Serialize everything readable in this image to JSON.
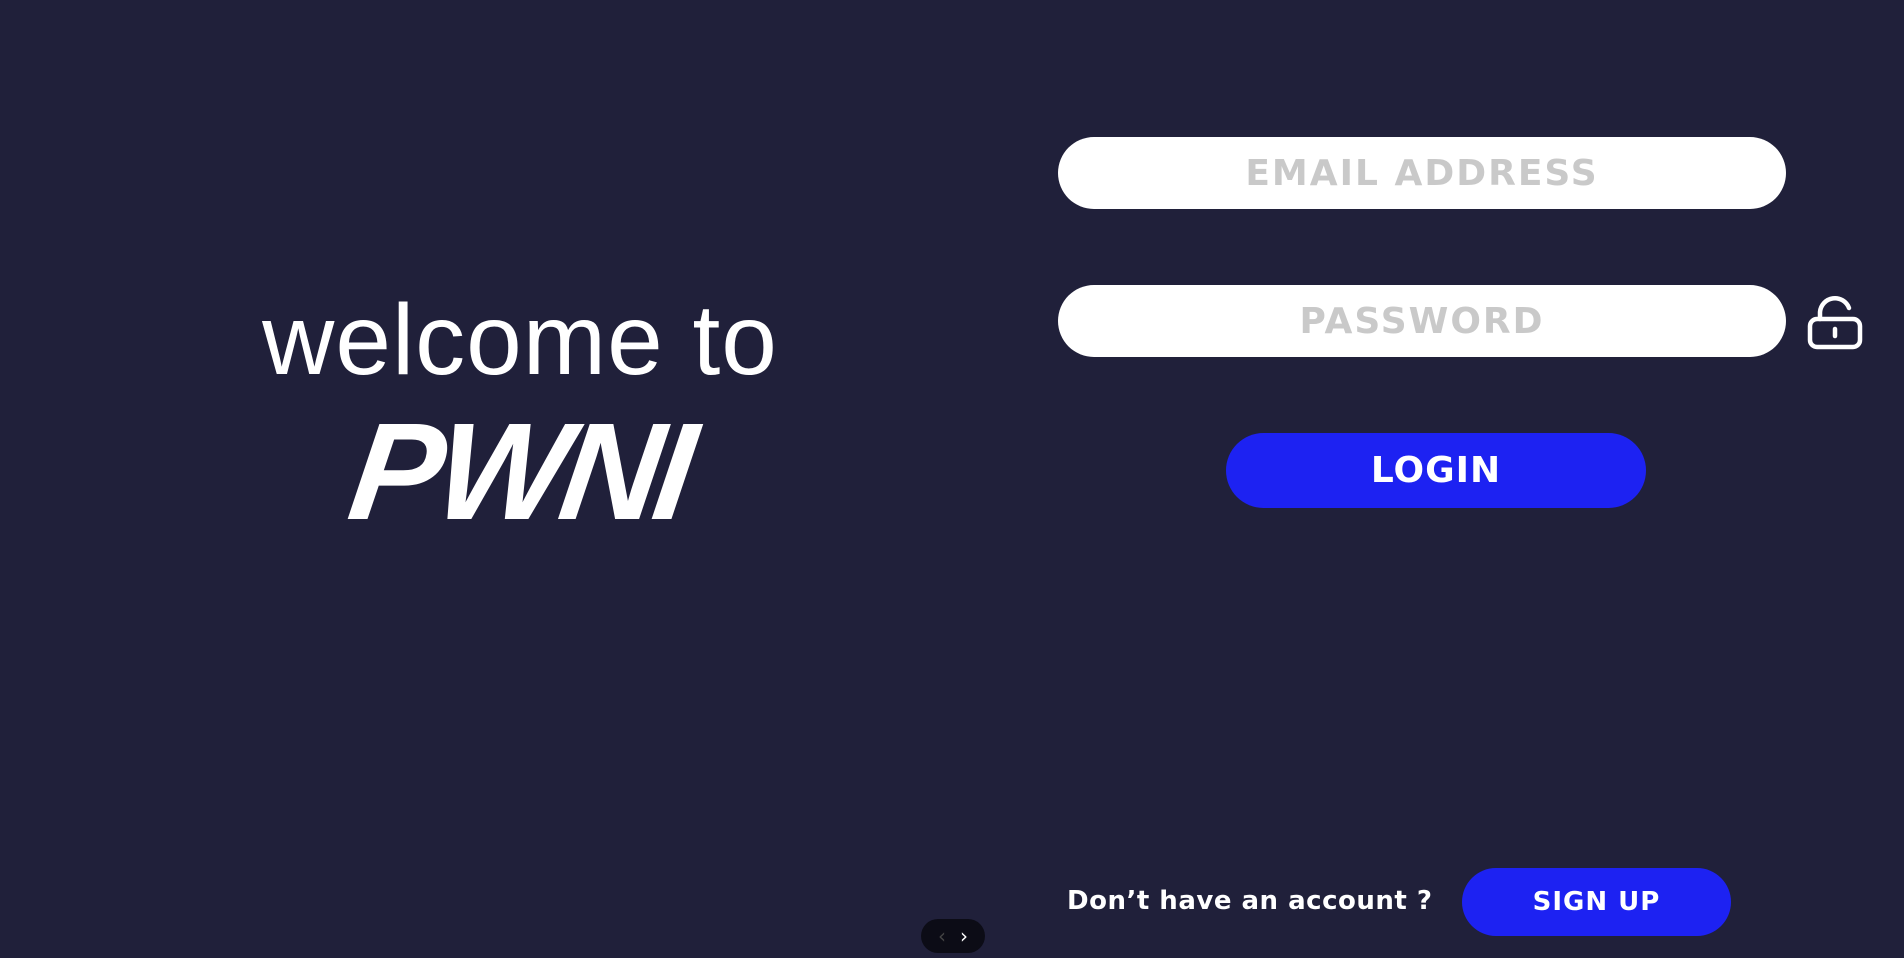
{
  "welcome": {
    "text": "welcome to",
    "brand": "PWNI"
  },
  "form": {
    "email": {
      "value": "",
      "placeholder": "EMAIL ADDRESS"
    },
    "password": {
      "value": "",
      "placeholder": "PASSWORD",
      "toggle_icon": "lock-open-icon"
    },
    "login_label": "LOGIN"
  },
  "signup": {
    "prompt": "Don’t have an account ?",
    "button_label": "SIGN UP"
  },
  "pager": {
    "prev_icon": "chevron-left-icon",
    "next_icon": "chevron-right-icon",
    "prev_glyph": "‹",
    "next_glyph": "›"
  },
  "colors": {
    "background": "#20203a",
    "accent": "#1d22f2",
    "field": "#ffffff",
    "placeholder": "#c9c9c9"
  }
}
